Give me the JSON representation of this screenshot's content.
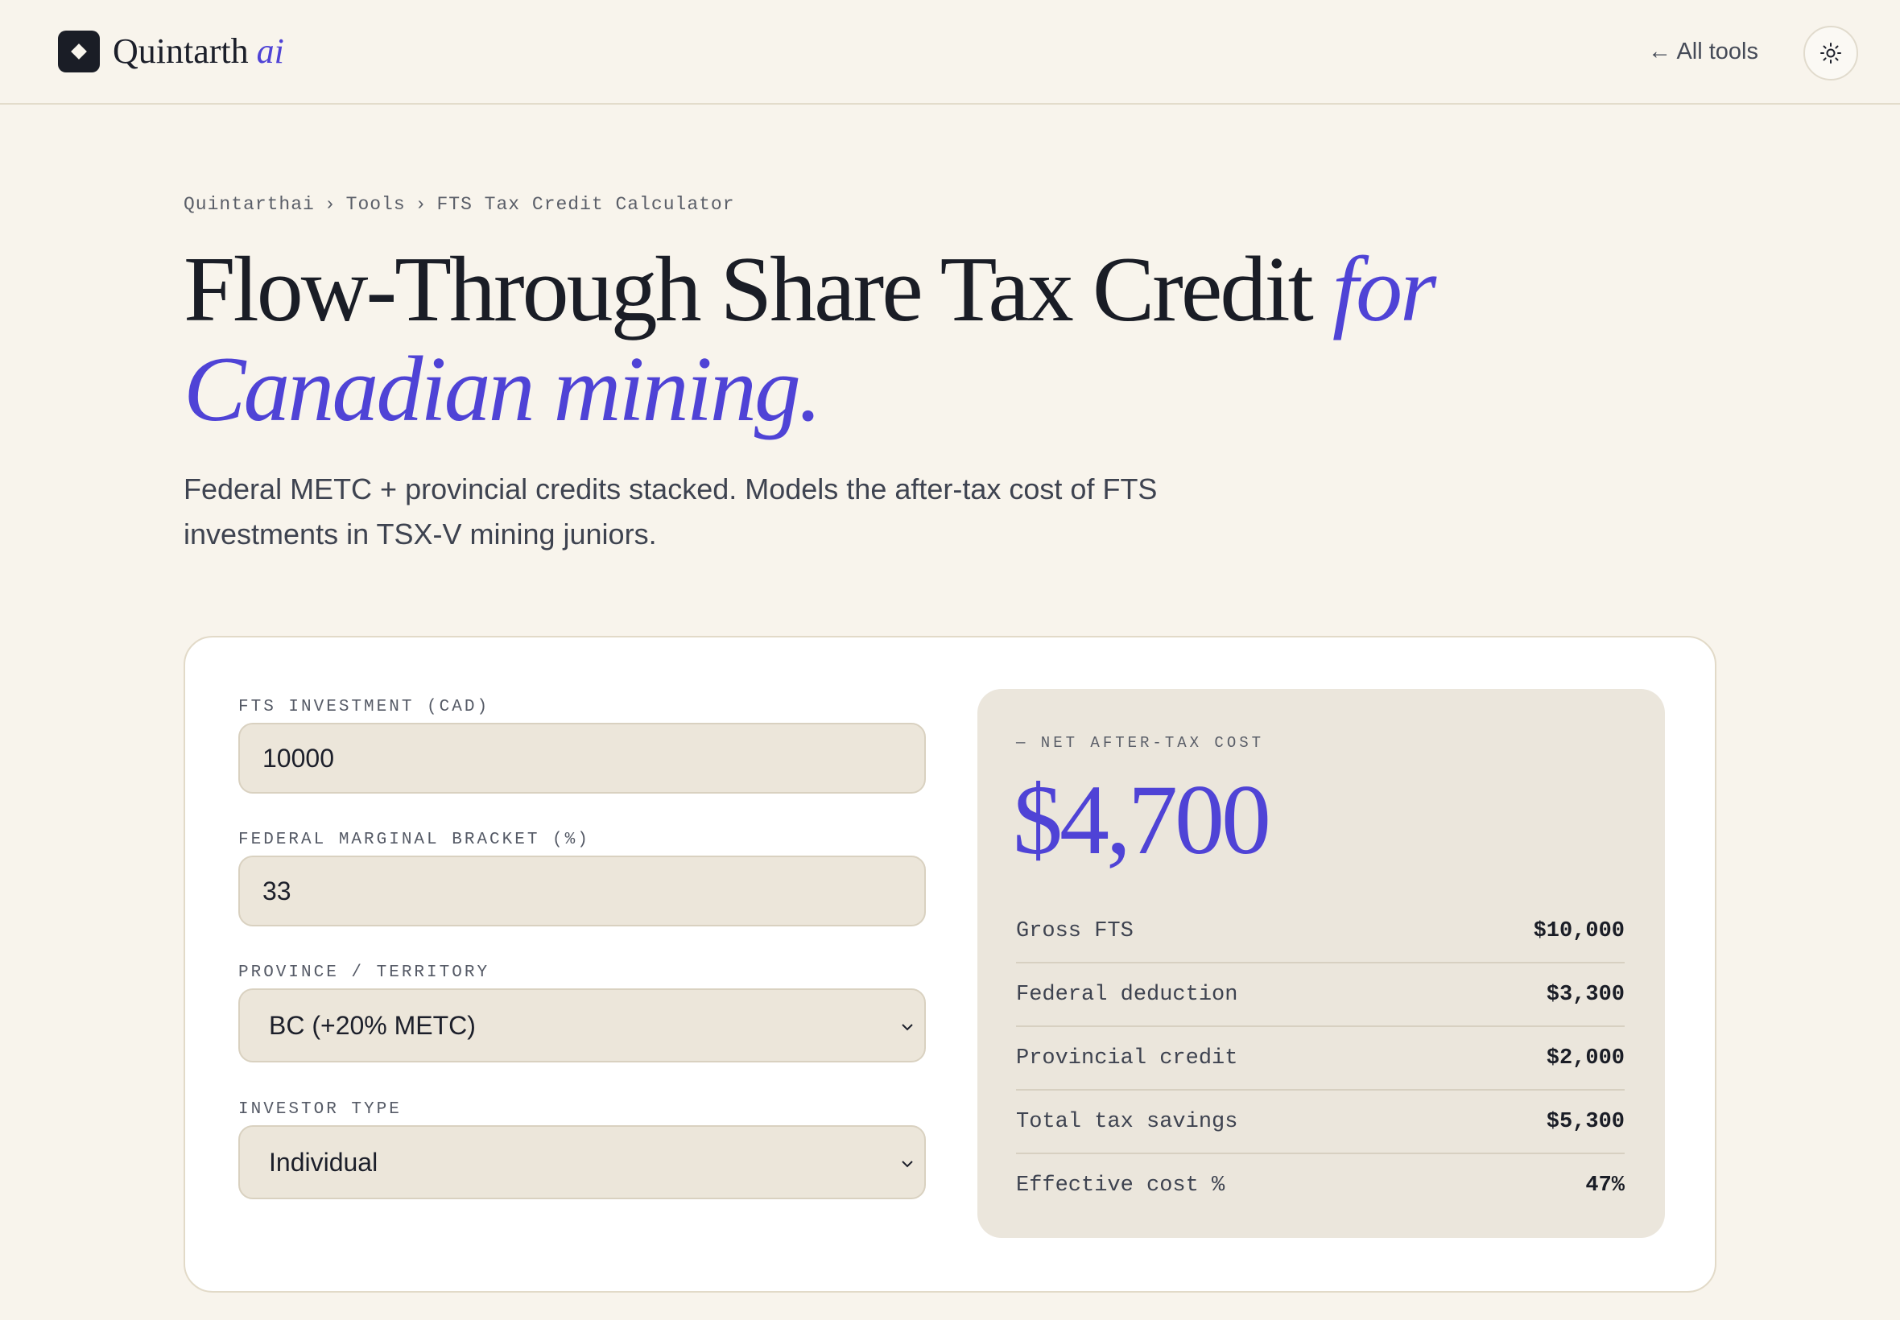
{
  "header": {
    "brand_name": "Quintarth",
    "brand_suffix": "ai",
    "logo_icon": "diamond-icon",
    "all_tools_label": "← All tools",
    "theme_toggle_icon": "sun-icon"
  },
  "breadcrumb": {
    "items": [
      "Quintarthai",
      "Tools",
      "FTS Tax Credit Calculator"
    ],
    "separator": "›"
  },
  "hero": {
    "title_main": "Flow-Through Share Tax Credit",
    "title_accent": "for Canadian mining.",
    "subtitle": "Federal METC + provincial credits stacked. Models the after-tax cost of FTS investments in TSX-V mining juniors."
  },
  "form": {
    "investment": {
      "label": "FTS INVESTMENT (CAD)",
      "value": "10000"
    },
    "bracket": {
      "label": "FEDERAL MARGINAL BRACKET (%)",
      "value": "33"
    },
    "province": {
      "label": "PROVINCE / TERRITORY",
      "selected": "BC (+20% METC)"
    },
    "investor_type": {
      "label": "INVESTOR TYPE",
      "selected": "Individual"
    }
  },
  "result": {
    "label": "— NET AFTER-TAX COST",
    "value": "$4,700",
    "rows": [
      {
        "label": "Gross FTS",
        "value": "$10,000"
      },
      {
        "label": "Federal deduction",
        "value": "$3,300"
      },
      {
        "label": "Provincial credit",
        "value": "$2,000"
      },
      {
        "label": "Total tax savings",
        "value": "$5,300"
      },
      {
        "label": "Effective cost %",
        "value": "47%"
      }
    ]
  },
  "colors": {
    "background": "#f8f4ec",
    "accent": "#4f43d6",
    "ink": "#1a1d26",
    "field": "#ece6da"
  }
}
